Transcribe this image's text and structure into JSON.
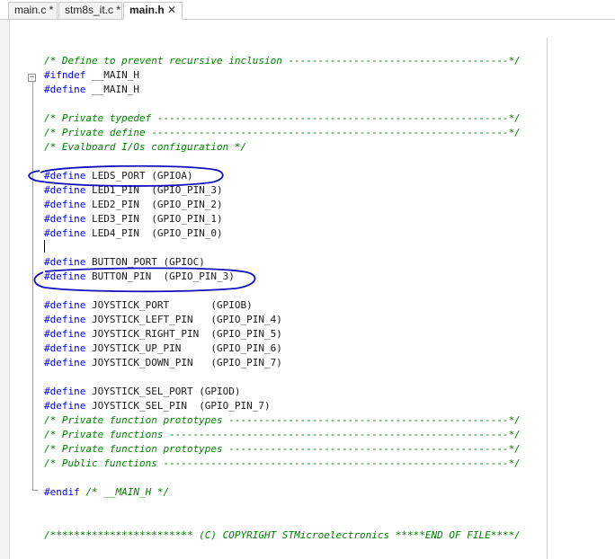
{
  "tabs": [
    {
      "label": "main.c *"
    },
    {
      "label": "stm8s_it.c *"
    },
    {
      "label": "main.h",
      "close": "✕"
    }
  ],
  "code_lines": [
    {
      "parts": [
        {
          "cls": "cm",
          "text": "/* Define to prevent recursive inclusion -------------------------------------*/"
        }
      ]
    },
    {
      "parts": [
        {
          "cls": "kw",
          "text": "#ifndef"
        },
        {
          "cls": "",
          "text": " __MAIN_H"
        }
      ]
    },
    {
      "parts": [
        {
          "cls": "kw",
          "text": "#define"
        },
        {
          "cls": "",
          "text": " __MAIN_H"
        }
      ]
    },
    {
      "parts": []
    },
    {
      "parts": [
        {
          "cls": "cm",
          "text": "/* Private typedef -----------------------------------------------------------*/"
        }
      ]
    },
    {
      "parts": [
        {
          "cls": "cm",
          "text": "/* Private define ------------------------------------------------------------*/"
        }
      ]
    },
    {
      "parts": [
        {
          "cls": "cm",
          "text": "/* Evalboard I/Os configuration */"
        }
      ]
    },
    {
      "parts": []
    },
    {
      "parts": [
        {
          "cls": "kw",
          "text": "#define"
        },
        {
          "cls": "",
          "text": " LEDS_PORT (GPIOA)"
        }
      ]
    },
    {
      "parts": [
        {
          "cls": "kw",
          "text": "#define"
        },
        {
          "cls": "",
          "text": " LED1_PIN  (GPIO_PIN_3)"
        }
      ]
    },
    {
      "parts": [
        {
          "cls": "kw",
          "text": "#define"
        },
        {
          "cls": "",
          "text": " LED2_PIN  (GPIO_PIN_2)"
        }
      ]
    },
    {
      "parts": [
        {
          "cls": "kw",
          "text": "#define"
        },
        {
          "cls": "",
          "text": " LED3_PIN  (GPIO_PIN_1)"
        }
      ]
    },
    {
      "parts": [
        {
          "cls": "kw",
          "text": "#define"
        },
        {
          "cls": "",
          "text": " LED4_PIN  (GPIO_PIN_0)"
        }
      ]
    },
    {
      "parts": []
    },
    {
      "parts": [
        {
          "cls": "kw",
          "text": "#define"
        },
        {
          "cls": "",
          "text": " BUTTON_PORT (GPIOC)"
        }
      ]
    },
    {
      "parts": [
        {
          "cls": "kw",
          "text": "#define"
        },
        {
          "cls": "",
          "text": " BUTTON_PIN  (GPIO_PIN_3)"
        }
      ]
    },
    {
      "parts": []
    },
    {
      "parts": [
        {
          "cls": "kw",
          "text": "#define"
        },
        {
          "cls": "",
          "text": " JOYSTICK_PORT       (GPIOB)"
        }
      ]
    },
    {
      "parts": [
        {
          "cls": "kw",
          "text": "#define"
        },
        {
          "cls": "",
          "text": " JOYSTICK_LEFT_PIN   (GPIO_PIN_4)"
        }
      ]
    },
    {
      "parts": [
        {
          "cls": "kw",
          "text": "#define"
        },
        {
          "cls": "",
          "text": " JOYSTICK_RIGHT_PIN  (GPIO_PIN_5)"
        }
      ]
    },
    {
      "parts": [
        {
          "cls": "kw",
          "text": "#define"
        },
        {
          "cls": "",
          "text": " JOYSTICK_UP_PIN     (GPIO_PIN_6)"
        }
      ]
    },
    {
      "parts": [
        {
          "cls": "kw",
          "text": "#define"
        },
        {
          "cls": "",
          "text": " JOYSTICK_DOWN_PIN   (GPIO_PIN_7)"
        }
      ]
    },
    {
      "parts": []
    },
    {
      "parts": [
        {
          "cls": "kw",
          "text": "#define"
        },
        {
          "cls": "",
          "text": " JOYSTICK_SEL_PORT (GPIOD)"
        }
      ]
    },
    {
      "parts": [
        {
          "cls": "kw",
          "text": "#define"
        },
        {
          "cls": "",
          "text": " JOYSTICK_SEL_PIN  (GPIO_PIN_7)"
        }
      ]
    },
    {
      "parts": [
        {
          "cls": "cm",
          "text": "/* Private function prototypes -----------------------------------------------*/"
        }
      ]
    },
    {
      "parts": [
        {
          "cls": "cm",
          "text": "/* Private functions ---------------------------------------------------------*/"
        }
      ]
    },
    {
      "parts": [
        {
          "cls": "cm",
          "text": "/* Private function prototypes -----------------------------------------------*/"
        }
      ]
    },
    {
      "parts": [
        {
          "cls": "cm",
          "text": "/* Public functions ----------------------------------------------------------*/"
        }
      ]
    },
    {
      "parts": []
    },
    {
      "parts": [
        {
          "cls": "kw",
          "text": "#endif"
        },
        {
          "cls": "cm",
          "text": " /* __MAIN_H */"
        }
      ]
    },
    {
      "parts": []
    },
    {
      "parts": []
    },
    {
      "parts": [
        {
          "cls": "cm",
          "text": "/************************ (C) COPYRIGHT STMicroelectronics *****END OF FILE****/"
        }
      ]
    }
  ],
  "fold_marker": "−",
  "colors": {
    "keyword": "#0000ff",
    "comment": "#008000",
    "annotation": "#1010c0"
  }
}
